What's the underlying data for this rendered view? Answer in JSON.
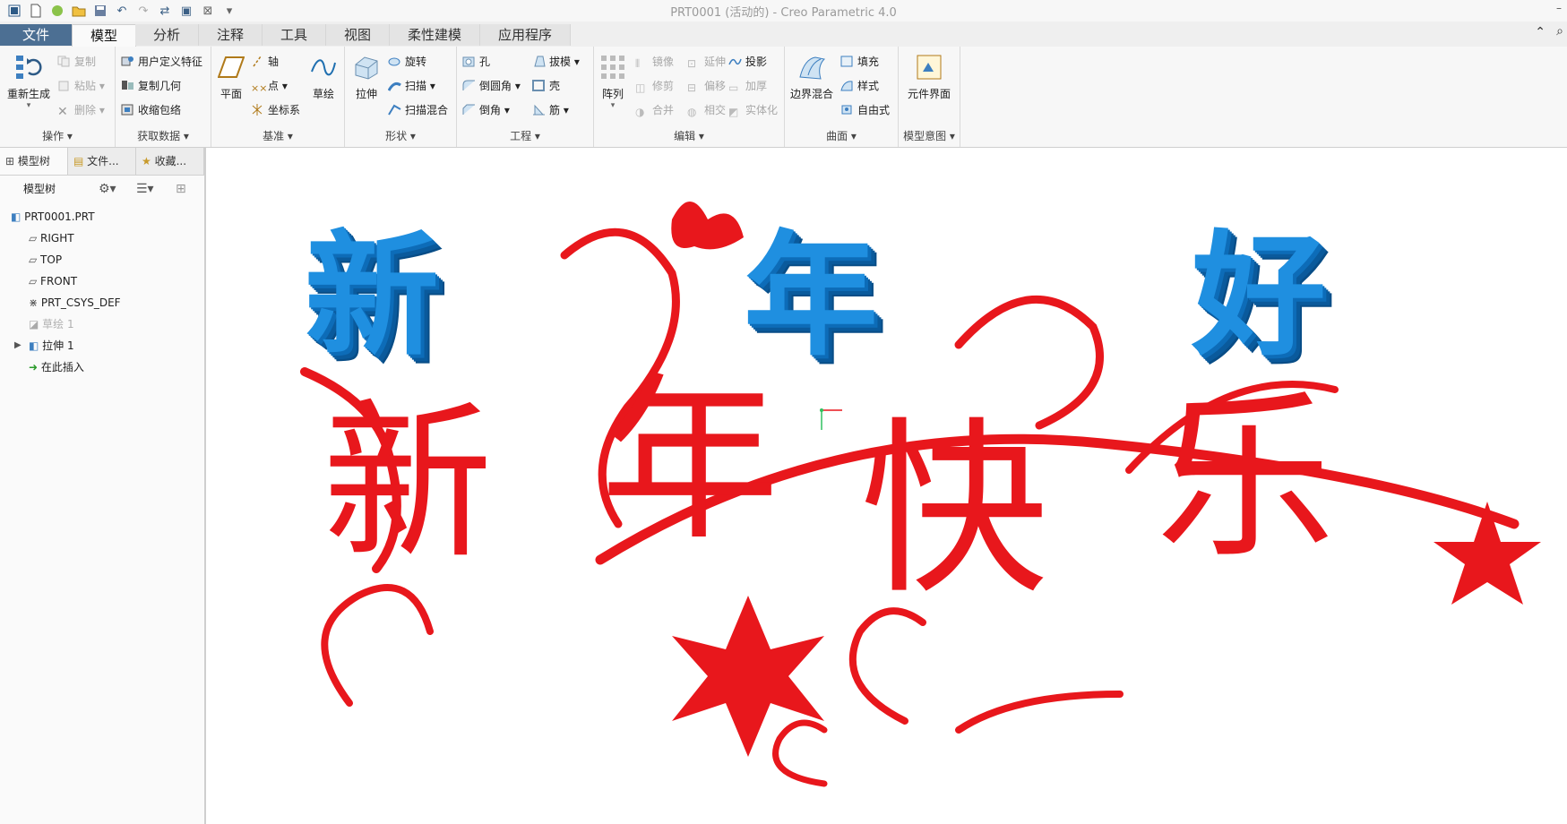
{
  "window": {
    "title": "PRT0001 (活动的) - Creo Parametric 4.0"
  },
  "quick_access": {
    "icons": [
      "app-icon",
      "new-icon",
      "open-session-icon",
      "open-icon",
      "save-icon",
      "undo-icon",
      "redo-icon",
      "regenerate-icon",
      "windows-icon",
      "close-icon",
      "customize-icon"
    ]
  },
  "tabs": [
    {
      "label": "文件"
    },
    {
      "label": "模型"
    },
    {
      "label": "分析"
    },
    {
      "label": "注释"
    },
    {
      "label": "工具"
    },
    {
      "label": "视图"
    },
    {
      "label": "柔性建模"
    },
    {
      "label": "应用程序"
    }
  ],
  "ribbon": {
    "ops": {
      "label": "操作",
      "regen": "重新生成",
      "copy": "复制",
      "paste": "粘贴",
      "delete": "删除"
    },
    "getdata": {
      "label": "获取数据",
      "udf": "用户定义特征",
      "copygeom": "复制几何",
      "shrink": "收缩包络"
    },
    "datum": {
      "label": "基准",
      "plane": "平面",
      "axis": "轴",
      "point": "点",
      "csys": "坐标系",
      "sketch": "草绘"
    },
    "shape": {
      "label": "形状",
      "extrude": "拉伸",
      "revolve": "旋转",
      "sweep": "扫描",
      "sweptblend": "扫描混合"
    },
    "engineering": {
      "label": "工程",
      "hole": "孔",
      "round": "倒圆角",
      "chamfer": "倒角",
      "draft": "拔模",
      "shell": "壳",
      "rib": "筋"
    },
    "editing": {
      "label": "编辑",
      "pattern": "阵列",
      "mirror": "镜像",
      "trim": "修剪",
      "merge": "合并",
      "extend": "延伸",
      "offset": "偏移",
      "intersect": "相交",
      "project": "投影",
      "thicken": "加厚",
      "solidify": "实体化"
    },
    "surfaces": {
      "label": "曲面",
      "boundary": "边界混合",
      "fill": "填充",
      "style": "样式",
      "freestyle": "自由式"
    },
    "intent": {
      "label": "模型意图",
      "component": "元件界面"
    }
  },
  "sidebar": {
    "tabs": [
      {
        "label": "模型树"
      },
      {
        "label": "文件..."
      },
      {
        "label": "收藏..."
      }
    ],
    "toolbar_label": "模型树",
    "tree": [
      {
        "label": "PRT0001.PRT",
        "icon": "part-icon"
      },
      {
        "label": "RIGHT",
        "icon": "datum-plane-icon"
      },
      {
        "label": "TOP",
        "icon": "datum-plane-icon"
      },
      {
        "label": "FRONT",
        "icon": "datum-plane-icon"
      },
      {
        "label": "PRT_CSYS_DEF",
        "icon": "csys-icon"
      },
      {
        "label": "草绘 1",
        "icon": "sketch-icon"
      },
      {
        "label": "拉伸 1",
        "icon": "extrude-icon"
      },
      {
        "label": "在此插入",
        "icon": "insert-arrow-icon"
      }
    ]
  },
  "canvas": {
    "blue_text": [
      "新",
      "年",
      "好"
    ],
    "red_text": [
      "新",
      "年",
      "快",
      "乐"
    ],
    "colors": {
      "blue": "#1f8fe0",
      "red": "#e8171c"
    }
  }
}
